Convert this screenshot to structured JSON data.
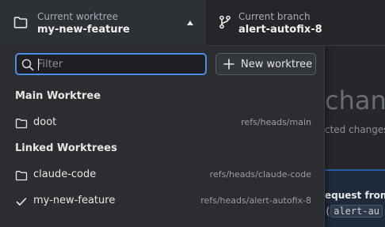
{
  "toolbar": {
    "worktree": {
      "label": "Current worktree",
      "value": "my-new-feature",
      "icon": "folder-icon"
    },
    "branch": {
      "label": "Current branch",
      "value": "alert-autofix-8",
      "icon": "git-branch-icon"
    }
  },
  "dropdown": {
    "filter": {
      "placeholder": "Filter",
      "value": ""
    },
    "new_worktree_label": "New worktree",
    "sections": {
      "main": {
        "title": "Main Worktree",
        "items": [
          {
            "name": "doot",
            "ref": "refs/heads/main",
            "icon": "folder-icon"
          }
        ]
      },
      "linked": {
        "title": "Linked Worktrees",
        "items": [
          {
            "name": "claude-code",
            "ref": "refs/heads/claude-code",
            "icon": "folder-icon"
          },
          {
            "name": "my-new-feature",
            "ref": "refs/heads/alert-autofix-8",
            "icon": "check-icon",
            "selected": true
          }
        ]
      }
    }
  },
  "background": {
    "heading_fragment": "chan",
    "subtext_fragment": "cted changes",
    "request_fragment": "equest from",
    "code_fragment": "alert-au"
  },
  "colors": {
    "accent": "#4c8fe0",
    "dropdown_bg": "#2b2d31",
    "toolbar_bg": "#24262a"
  }
}
